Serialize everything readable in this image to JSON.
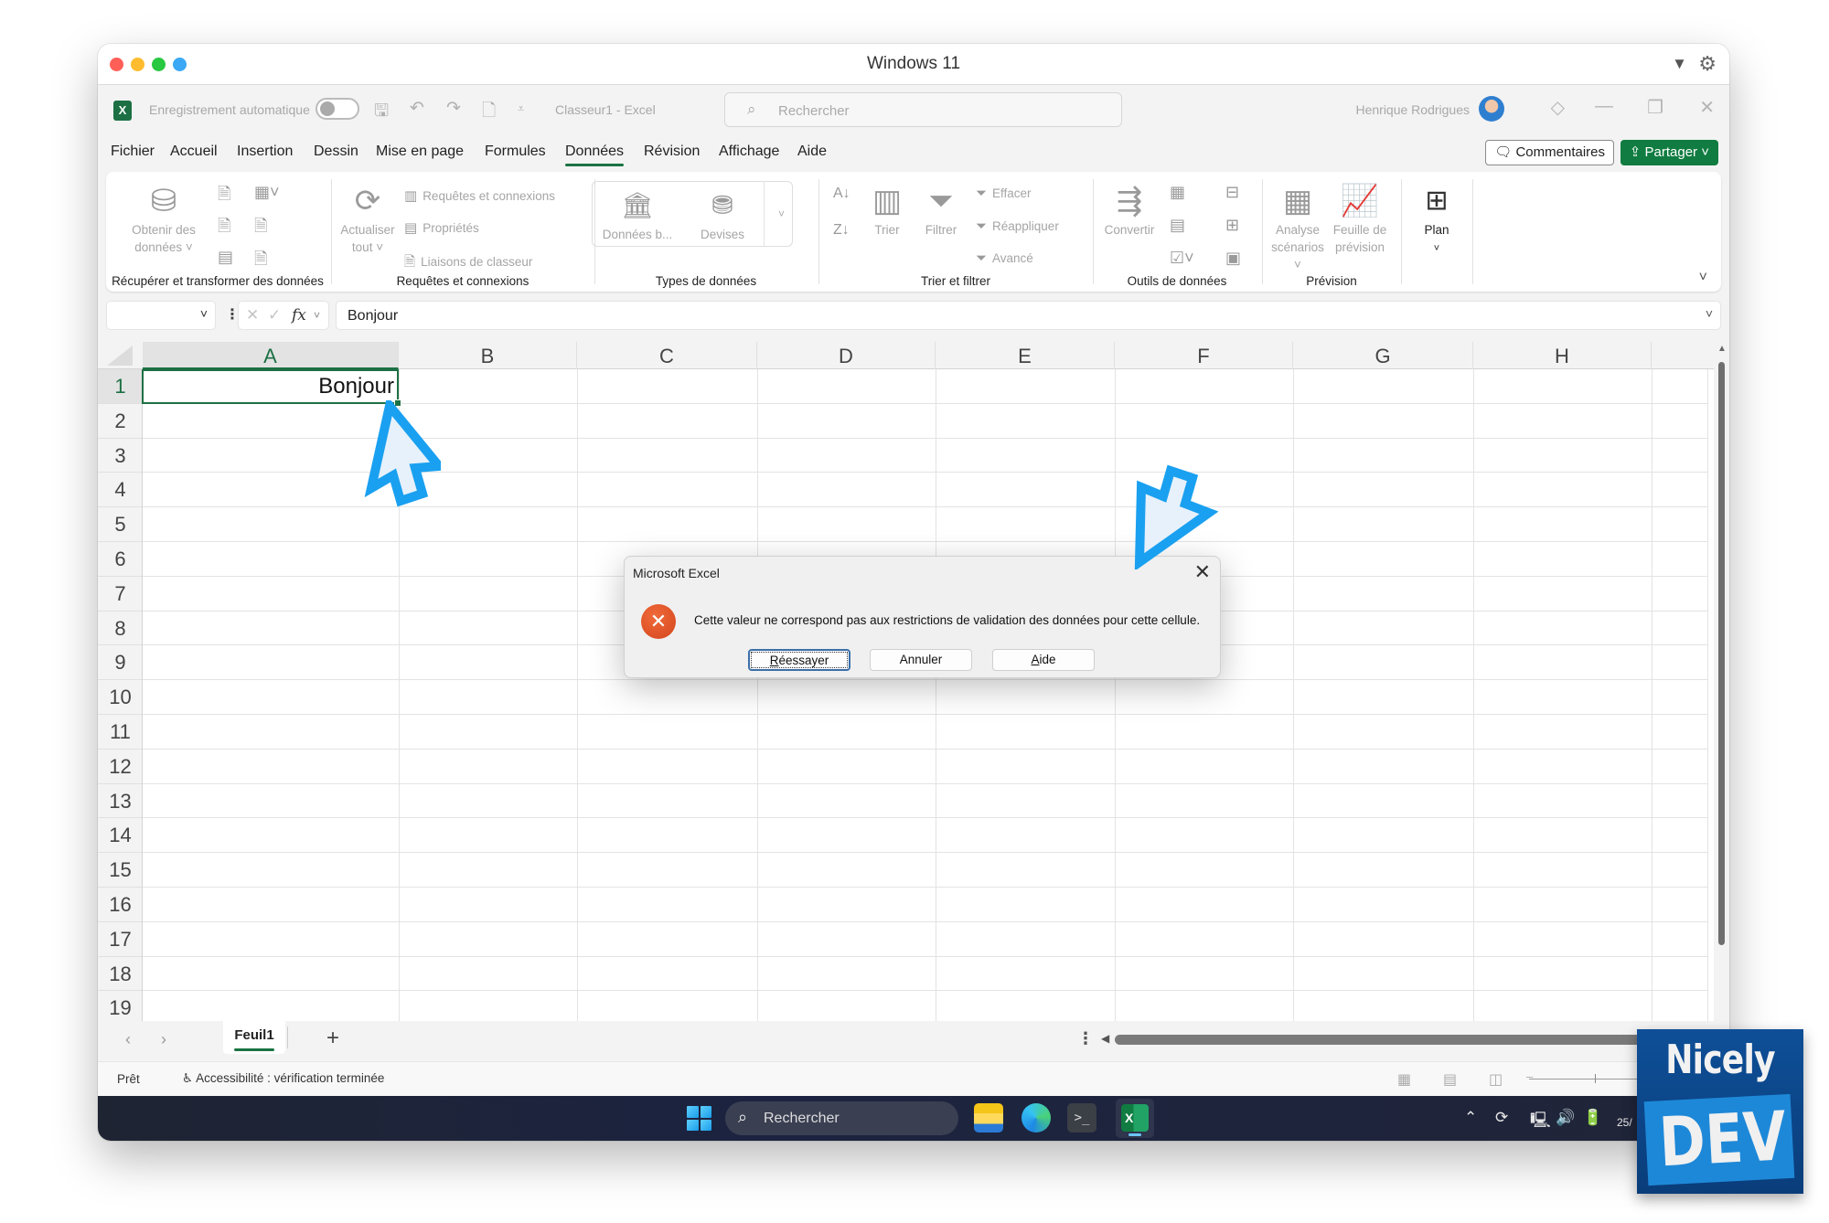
{
  "mac_window": {
    "title": "Windows 11",
    "traffic_lights": [
      "#ff5f57",
      "#febc2e",
      "#28c840",
      "#3aa8f5"
    ],
    "filter_icon": "▼",
    "settings_icon": "⚙"
  },
  "excel_titlebar": {
    "app_icon": "X",
    "autosave_label": "Enregistrement automatique",
    "autosave_on": false,
    "doc_title": "Classeur1  -  Excel",
    "search_placeholder": "Rechercher",
    "user_name": "Henrique Rodrigues",
    "icons": {
      "save": "🖫",
      "undo": "↶",
      "redo": "↷",
      "new": "🗋",
      "customize": "⩡",
      "premium": "◇",
      "minimize": "—",
      "restore": "❐",
      "close": "✕"
    }
  },
  "menu": {
    "tabs": [
      "Fichier",
      "Accueil",
      "Insertion",
      "Dessin",
      "Mise en page",
      "Formules",
      "Données",
      "Révision",
      "Affichage",
      "Aide"
    ],
    "active_tab": "Données",
    "comments_label": "Commentaires",
    "share_label": "Partager"
  },
  "ribbon": {
    "groups": [
      {
        "label": "Récupérer et transformer des données",
        "big_button": "Obtenir des données ˅"
      },
      {
        "label": "Requêtes et connexions",
        "big_button": "Actualiser tout ˅",
        "items": [
          "Requêtes et connexions",
          "Propriétés",
          "Liaisons de classeur"
        ]
      },
      {
        "label": "Types de données",
        "items": [
          "Données b...",
          "Devises"
        ]
      },
      {
        "label": "Trier et filtrer",
        "items": [
          "Trier",
          "Filtrer",
          "Effacer",
          "Réappliquer",
          "Avancé"
        ]
      },
      {
        "label": "Outils de données",
        "big_button": "Convertir"
      },
      {
        "label": "Prévision",
        "items": [
          "Analyse scénarios ˅",
          "Feuille de prévision"
        ]
      },
      {
        "label": "",
        "big_button": "Plan"
      }
    ]
  },
  "formula_bar": {
    "name_box": "",
    "fx_label": "fx",
    "value": "Bonjour"
  },
  "sheet": {
    "columns": [
      "A",
      "B",
      "C",
      "D",
      "E",
      "F",
      "G",
      "H"
    ],
    "rows": [
      "1",
      "2",
      "3",
      "4",
      "5",
      "6",
      "7",
      "8",
      "9",
      "10",
      "11",
      "12",
      "13",
      "14",
      "15",
      "16",
      "17",
      "18",
      "19"
    ],
    "selected_cell": "A1",
    "cells": {
      "A1": "Bonjour"
    },
    "tabs": [
      "Feuil1"
    ],
    "add_sheet": "+"
  },
  "status_bar": {
    "ready": "Prêt",
    "accessibility": "Accessibilité : vérification terminée"
  },
  "dialog": {
    "title": "Microsoft Excel",
    "message": "Cette valeur ne correspond pas aux restrictions de validation des données pour cette cellule.",
    "buttons": [
      "Réessayer",
      "Annuler",
      "Aide"
    ],
    "default_button": "Réessayer",
    "icon": "error"
  },
  "taskbar": {
    "search_placeholder": "Rechercher",
    "apps": [
      "file-explorer",
      "edge",
      "terminal",
      "excel"
    ],
    "clock_partial": "25/"
  },
  "watermark": {
    "line1": "Nicely",
    "line2": "DEV"
  },
  "colors": {
    "excel_green": "#107c41",
    "selection_green": "#1d7044",
    "annotation_blue": "#1aa0f0",
    "error_orange": "#e0522a"
  }
}
